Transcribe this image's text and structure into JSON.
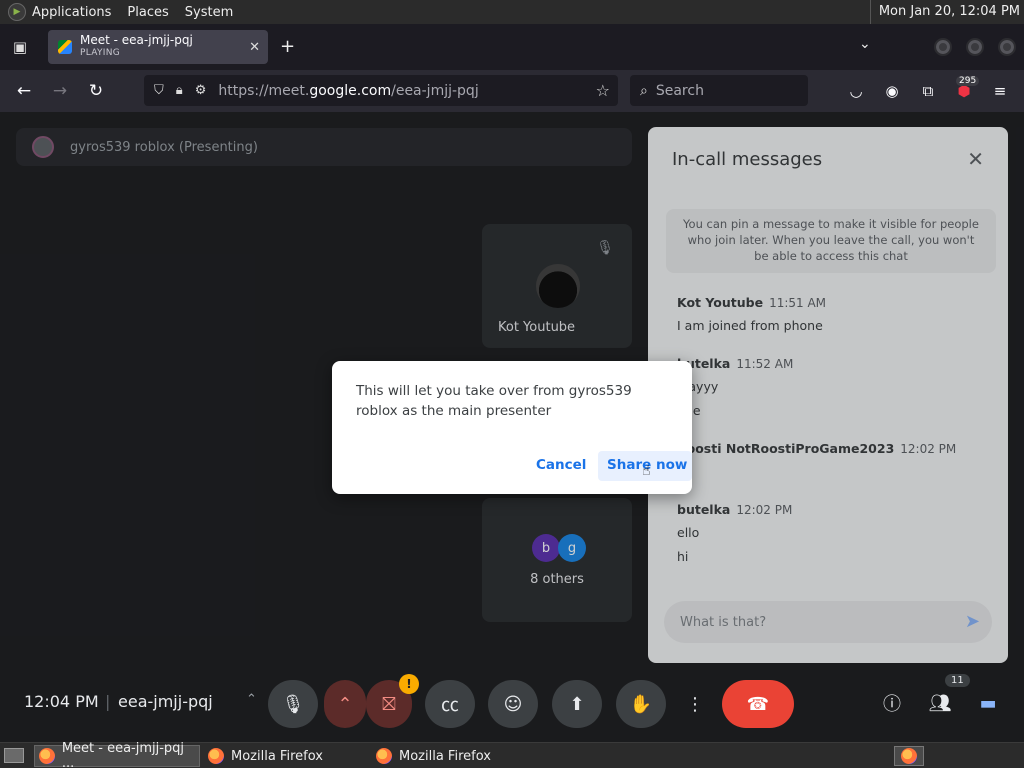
{
  "panel": {
    "menus": [
      "Applications",
      "Places",
      "System"
    ],
    "clock": "Mon Jan 20, 12:04 PM"
  },
  "browser": {
    "tab": {
      "title": "Meet - eea-jmjj-pqj",
      "status": "PLAYING"
    },
    "url_prefix": "https://meet.",
    "url_domain": "google.com",
    "url_path": "/eea-jmjj-pqj",
    "search_placeholder": "Search",
    "extension_badge": "295"
  },
  "meet": {
    "presenting_label": "gyros539 roblox (Presenting)",
    "tile_name": "Kot Youtube",
    "others_chips": [
      "b",
      "g"
    ],
    "others_label": "8 others",
    "meeting_time": "12:04 PM",
    "meeting_code": "eea-jmjj-pqj",
    "participant_count": "11",
    "camera_warning": "!"
  },
  "chat": {
    "title": "In-call messages",
    "pin_note": "You can pin a message to make it visible for people who join later. When you leave the call, you won't be able to access this chat",
    "messages": [
      {
        "who": "Kot Youtube",
        "time": "11:51 AM",
        "lines": [
          "I am joined from phone"
        ]
      },
      {
        "who": "butelka",
        "time": "11:52 AM",
        "lines": [
          "hiayyy",
          "hde"
        ]
      },
      {
        "who": "Roosti NotRoostiProGame2023",
        "time": "12:02 PM",
        "lines": [
          "hi"
        ]
      },
      {
        "who": "butelka",
        "time": "12:02 PM",
        "lines": [
          "ello",
          "hi"
        ]
      }
    ],
    "input_value": "What is that?"
  },
  "dialog": {
    "text": "This will let you take over from gyros539 roblox as the main presenter",
    "cancel_label": "Cancel",
    "confirm_label": "Share now"
  },
  "taskbar": {
    "items": [
      "Meet - eea-jmjj-pqj ...",
      "Mozilla Firefox",
      "Mozilla Firefox"
    ]
  },
  "colors": {
    "meet_background": "#202124",
    "hangup_red": "#ea4335",
    "link_blue": "#1a73e8"
  }
}
